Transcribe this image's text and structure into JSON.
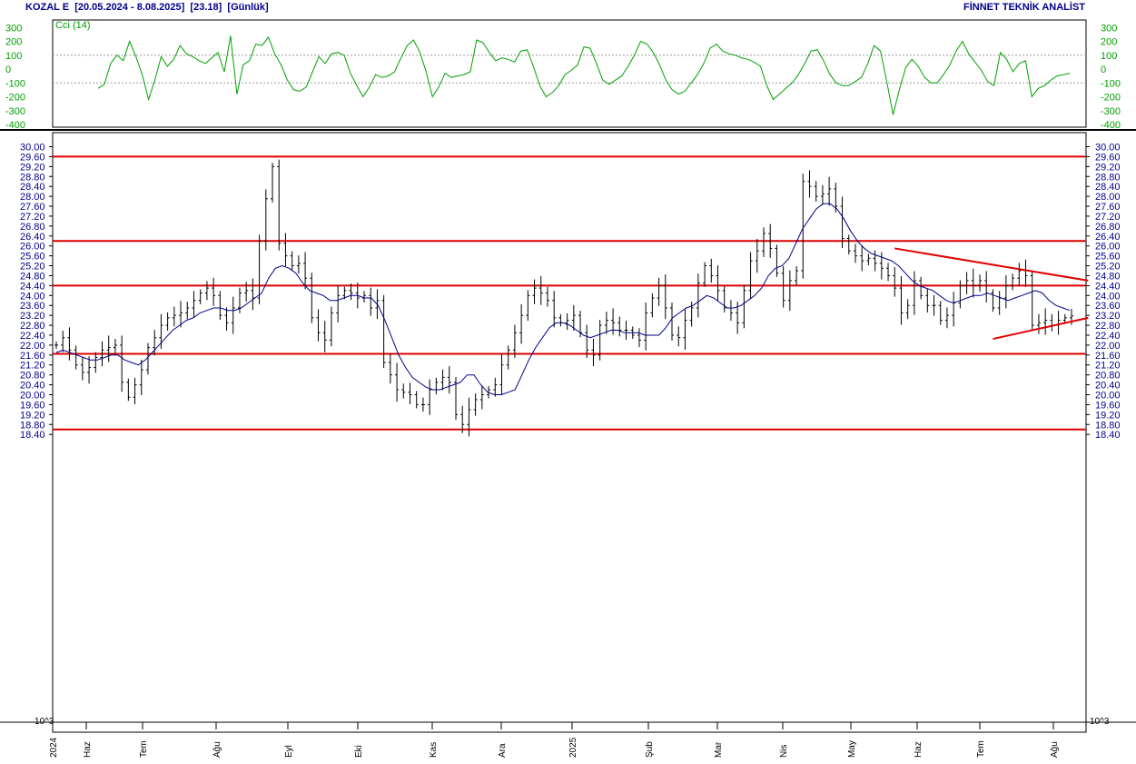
{
  "header": {
    "symbol": "KOZAL E",
    "range": "[20.05.2024 - 8.08.2025]",
    "last": "[23.18]",
    "period": "[Günlük]",
    "brand": "FİNNET TEKNİK ANALİST"
  },
  "chart_data": [
    {
      "type": "line",
      "panel": "indicator",
      "indicator_label": "Cci (14)",
      "ylim": [
        -400,
        400
      ],
      "yticks": [
        "300",
        "200",
        "100",
        "0",
        "-100",
        "-200",
        "-300",
        "-400"
      ],
      "ytick_values": [
        300,
        200,
        100,
        0,
        -100,
        -200,
        -300,
        -400
      ],
      "reference_lines": [
        100,
        -100
      ],
      "line_color": "#00a000",
      "series": [
        {
          "values": [
            -140,
            -110,
            40,
            100,
            60,
            200,
            90,
            -40,
            -220,
            -80,
            90,
            20,
            70,
            170,
            110,
            90,
            60,
            40,
            80,
            120,
            -20,
            240,
            -180,
            30,
            60,
            180,
            170,
            230,
            110,
            30,
            -80,
            -150,
            -160,
            -130,
            -20,
            90,
            40,
            110,
            120,
            100,
            -30,
            -120,
            -200,
            -130,
            -40,
            -60,
            -50,
            -20,
            80,
            170,
            210,
            120,
            -20,
            -200,
            -130,
            -30,
            -60,
            -50,
            -40,
            -20,
            210,
            190,
            120,
            60,
            80,
            70,
            50,
            130,
            140,
            20,
            -120,
            -200,
            -170,
            -120,
            -40,
            -10,
            30,
            160,
            150,
            40,
            -80,
            -110,
            -80,
            -50,
            20,
            100,
            200,
            180,
            120,
            30,
            -80,
            -150,
            -180,
            -160,
            -100,
            -40,
            40,
            150,
            180,
            130,
            110,
            100,
            80,
            70,
            50,
            20,
            -120,
            -220,
            -180,
            -140,
            -100,
            -40,
            40,
            130,
            140,
            60,
            -40,
            -100,
            -120,
            -120,
            -90,
            -60,
            40,
            170,
            130,
            -90,
            -330,
            -150,
            10,
            70,
            20,
            -60,
            -100,
            -100,
            -40,
            30,
            130,
            200,
            110,
            50,
            -10,
            -90,
            -120,
            120,
            70,
            -20,
            40,
            60,
            -200,
            -140,
            -120,
            -80,
            -50,
            -40,
            -30
          ]
        }
      ]
    },
    {
      "type": "ohlc",
      "panel": "price",
      "ylim": [
        18.4,
        30.4
      ],
      "yticks": [
        "30.00",
        "29.60",
        "29.20",
        "28.80",
        "28.40",
        "28.00",
        "27.60",
        "27.20",
        "26.80",
        "26.40",
        "26.00",
        "25.60",
        "25.20",
        "24.80",
        "24.40",
        "24.00",
        "23.60",
        "23.20",
        "22.80",
        "22.40",
        "22.00",
        "21.60",
        "21.20",
        "20.80",
        "20.40",
        "20.00",
        "19.60",
        "19.20",
        "18.80",
        "18.40"
      ],
      "ytick_values": [
        30,
        29.6,
        29.2,
        28.8,
        28.4,
        28,
        27.6,
        27.2,
        26.8,
        26.4,
        26,
        25.6,
        25.2,
        24.8,
        24.4,
        24,
        23.6,
        23.2,
        22.8,
        22.4,
        22,
        21.6,
        21.2,
        20.8,
        20.4,
        20,
        19.6,
        19.2,
        18.8,
        18.4
      ],
      "xlabels": [
        "2024",
        "Haz",
        "Tem",
        "Ağu",
        "Eyl",
        "Eki",
        "Kas",
        "Ara",
        "2025",
        "Şub",
        "Mar",
        "Nis",
        "May",
        "Haz",
        "Tem",
        "Ağu"
      ],
      "scale_note": "10^3",
      "bar_color": "#000000",
      "bars_close": [
        22.0,
        22.3,
        21.8,
        21.2,
        20.9,
        21.1,
        21.5,
        21.8,
        21.9,
        22.0,
        20.5,
        19.9,
        20.4,
        21.0,
        21.9,
        22.3,
        22.8,
        23.1,
        23.2,
        23.3,
        23.5,
        23.8,
        24.1,
        24.3,
        24.0,
        23.2,
        22.9,
        23.5,
        24.1,
        24.2,
        23.9,
        26.2,
        27.9,
        29.2,
        26.1,
        25.6,
        25.2,
        25.3,
        24.7,
        23.1,
        22.5,
        22.2,
        23.3,
        24.0,
        24.2,
        24.1,
        23.9,
        24.0,
        23.5,
        23.8,
        21.3,
        20.8,
        20.2,
        20.1,
        20.0,
        19.6,
        19.6,
        20.2,
        20.5,
        20.7,
        20.5,
        19.2,
        18.8,
        19.4,
        19.8,
        20.0,
        20.2,
        20.4,
        21.2,
        21.8,
        22.5,
        23.2,
        24.0,
        24.3,
        24.1,
        23.8,
        23.1,
        22.9,
        23.0,
        23.2,
        22.5,
        21.8,
        21.6,
        22.8,
        23.0,
        22.9,
        22.6,
        22.6,
        22.4,
        22.2,
        23.3,
        23.9,
        24.4,
        23.5,
        22.4,
        22.3,
        23.0,
        23.5,
        24.5,
        25.2,
        24.8,
        24.2,
        23.5,
        23.3,
        22.9,
        24.2,
        25.4,
        25.8,
        26.5,
        25.9,
        24.9,
        23.8,
        24.6,
        25.0,
        28.6,
        28.4,
        28.0,
        28.1,
        28.3,
        27.6,
        26.3,
        25.8,
        25.6,
        25.4,
        25.5,
        25.3,
        25.1,
        24.8,
        24.3,
        23.3,
        23.6,
        24.6,
        24.0,
        23.6,
        23.6,
        23.0,
        23.2,
        23.7,
        24.4,
        24.6,
        24.4,
        24.6,
        24.1,
        23.5,
        23.9,
        24.4,
        24.7,
        25.0,
        24.8,
        22.8,
        22.9,
        23.0,
        22.8,
        23.0,
        23.1,
        23.18
      ],
      "moving_average": [
        21.7,
        21.8,
        21.7,
        21.6,
        21.5,
        21.4,
        21.4,
        21.5,
        21.6,
        21.6,
        21.4,
        21.3,
        21.2,
        21.4,
        21.7,
        22.0,
        22.3,
        22.6,
        22.8,
        23.0,
        23.1,
        23.3,
        23.4,
        23.5,
        23.5,
        23.4,
        23.4,
        23.5,
        23.7,
        23.9,
        24.1,
        24.7,
        25.1,
        25.2,
        25.1,
        24.9,
        24.5,
        24.2,
        24.1,
        24.0,
        23.8,
        23.8,
        23.9,
        24.0,
        24.0,
        23.9,
        23.9,
        23.6,
        23.0,
        22.3,
        21.6,
        21.1,
        20.7,
        20.5,
        20.3,
        20.2,
        20.2,
        20.3,
        20.4,
        20.5,
        20.8,
        20.8,
        20.4,
        20.1,
        20.0,
        20.0,
        20.1,
        20.2,
        20.8,
        21.4,
        21.9,
        22.3,
        22.7,
        22.9,
        22.9,
        22.8,
        22.6,
        22.4,
        22.3,
        22.4,
        22.5,
        22.6,
        22.6,
        22.5,
        22.5,
        22.5,
        22.4,
        22.4,
        22.4,
        22.7,
        23.1,
        23.3,
        23.5,
        23.6,
        23.8,
        24.0,
        23.9,
        23.7,
        23.5,
        23.5,
        23.6,
        23.8,
        24.0,
        24.3,
        24.8,
        25.1,
        25.2,
        25.5,
        26.1,
        26.7,
        27.1,
        27.5,
        27.7,
        27.7,
        27.5,
        27.1,
        26.6,
        26.2,
        25.9,
        25.7,
        25.6,
        25.5,
        25.4,
        25.2,
        24.9,
        24.6,
        24.4,
        24.3,
        24.2,
        24.0,
        23.8,
        23.7,
        23.8,
        23.9,
        24.0,
        24.0,
        24.1,
        24.0,
        23.9,
        23.8,
        23.9,
        24.0,
        24.1,
        24.2,
        24.1,
        23.8,
        23.6,
        23.5,
        23.4
      ],
      "horizontal_lines": [
        29.6,
        26.2,
        24.4,
        21.65,
        18.6
      ],
      "trendlines": [
        {
          "from": [
            128,
            25.9
          ],
          "to": [
            152,
            24.6
          ]
        },
        {
          "from": [
            143,
            22.25
          ],
          "to": [
            152,
            23.1
          ]
        }
      ],
      "lines_color": "#e00000"
    }
  ]
}
